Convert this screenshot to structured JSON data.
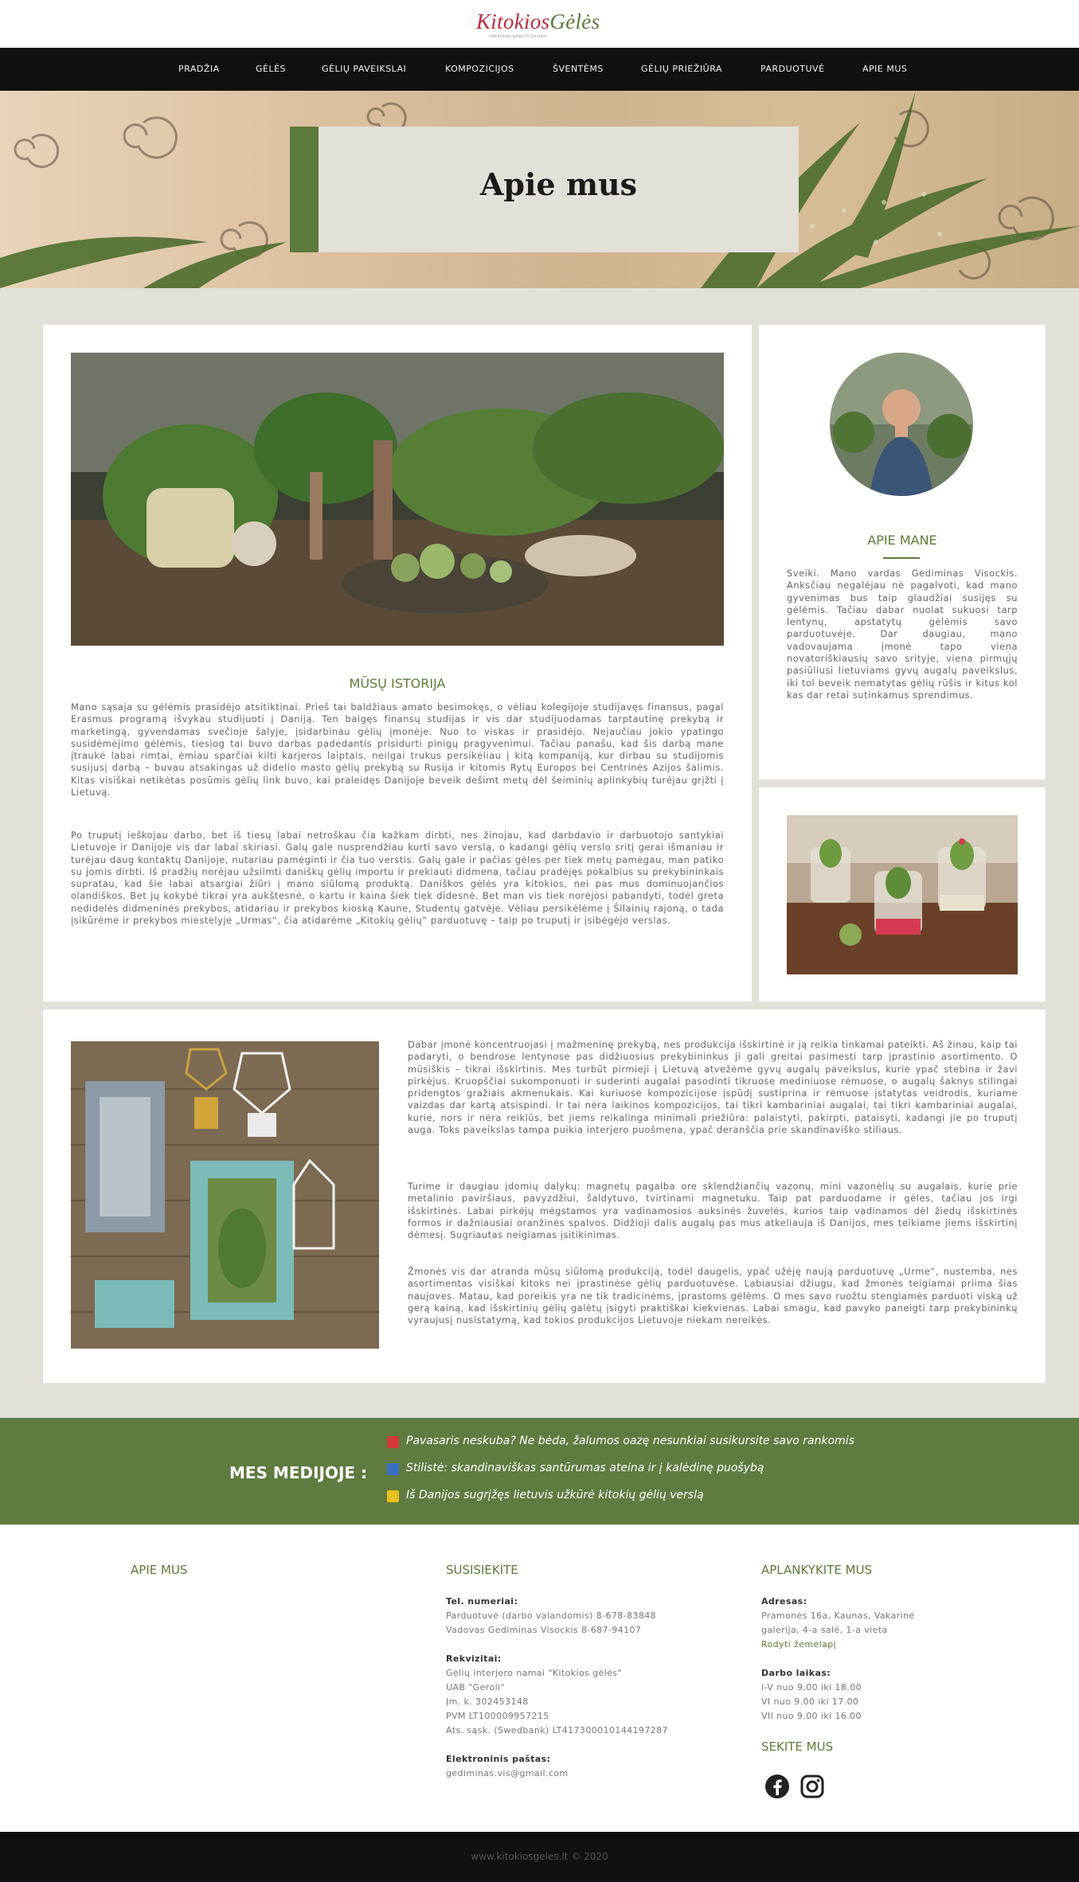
{
  "brand": {
    "logo_main_a": "Kitokios",
    "logo_main_b": "Gėlės",
    "logo_sub": "išskirtinės gėlės iš Danijos",
    "accent": "#5d7b3a"
  },
  "nav": [
    "PRADŽIA",
    "GĖLĖS",
    "GĖLIŲ PAVEIKSLAI",
    "KOMPOZICIJOS",
    "ŠVENTĖMS",
    "GĖLIŲ PRIEŽIŪRA",
    "PARDUOTUVĖ",
    "APIE MUS"
  ],
  "hero": {
    "title": "Apie mus"
  },
  "history": {
    "heading": "MŪSŲ ISTORIJA",
    "p1": "Mano sąsaja su gėlėmis prasidėjo atsitiktinai. Prieš tai baldžiaus amato besimokęs, o vėliau kolegijoje studijavęs finansus, pagal Erasmus programą išvykau studijuoti į Daniją. Ten baigęs finansų studijas ir vis dar studijuodamas tarptautinę prekybą ir marketingą, gyvendamas svečioje šalyje, įsidarbinau gėlių įmonėje. Nuo to viskas ir prasidėjo. Nejaučiau jokio ypatingo susidėmėjimo gėlėmis, tiesiog tai buvo darbas padedantis prisidurti pinigų pragyvenimui. Tačiau panašu, kad šis darbą mane įtraukė labai rimtai, ėmiau sparčiai kilti karjeros laiptais, neilgai trukus persikėliau į kitą kompaniją, kur dirbau su studijomis susijusį darbą – buvau atsakingas už didelio masto gėlių prekybą su Rusija ir kitomis Rytų Europos bei Centrinės Azijos šalimis. Kitas visiškai netikėtas posūmis gėlių link buvo, kai praleidęs Danijoje beveik dešimt metų dėl šeiminių aplinkybių turėjau grįžti į Lietuvą.",
    "p2": "Po truputį ieškojau darbo, bet iš tiesų labai netroškau čia kažkam dirbti, nes žinojau, kad darbdavio ir darbuotojo santykiai Lietuvoje ir Danijoje vis dar labai skiriasi. Galų gale nusprendžiau kurti savo verslą, o kadangi gėlių verslo sritį gerai išmaniau ir turėjau daug kontaktų Danijoje, nutariau pamėginti ir čia tuo verstis. Galų gale ir pačias gėles per tiek metų pamėgau, man patiko su jomis dirbti. Iš pradžių norėjau užsiimti daniškų gėlių importu ir prekiauti didmena, tačiau pradėjęs pokalbius su prekybininkais supratau, kad šie labai atsargiai žiūri į mano siūlomą produktą. Daniškos gėlės yra kitokios, nei pas mus dominuojančios olandiškos. Bet jų kokybė tikrai yra aukštesnė, o kartu ir kaina šiek tiek didesnė. Bet man vis tiek norėjosi pabandyti, todėl greta nedidelės didmeninės prekybos, atidariau ir prekybos kioską Kaune, Studentų gatvėje. Vėliau persikėlėme į Šilainių rajoną, o tada įsikūrėme ir prekybos miestelyje „Urmas“, čia atidarėme „Kitokių gėlių“ parduotuvę – taip po truputį ir įsibėgėjo verslas."
  },
  "about_me": {
    "heading": "APIE MANE",
    "text": "Sveiki. Mano vardas Gediminas Visockis. Anksčiau negalėjau nė pagalvoti, kad mano gyvenimas bus taip glaudžiai susijęs su gėlėmis. Tačiau dabar nuolat sukuosi tarp lentynų, apstatytų gėlėmis savo parduotuvėje. Dar daugiau, mano vadovaujama įmonė tapo viena novatoriškiausių savo srityje, viena pirmųjų pasiūliusi lietuviams gyvų augalų paveikslus, iki tol beveik nematytas gėlių rūšis ir kitus kol kas dar retai sutinkamus sprendimus."
  },
  "company": {
    "p1": "Dabar įmonė koncentruojasi į mažmeninę prekybą, nes produkcija išskirtinė ir ją reikia tinkamai pateikti. Aš žinau, kaip tai padaryti, o bendrose lentynose pas didžiuosius prekybininkus ji gali greitai pasimesti tarp įprastinio asortimento. O mūsiškis – tikrai išskirtinis. Mes turbūt pirmieji į Lietuvą atvežėme gyvų augalų paveikslus, kurie ypač stebina ir žavi pirkėjus. Kruopščiai sukomponuoti ir suderinti augalai pasodinti tikruose mediniuose rėmuose, o augalų šaknys stilingai pridengtos gražiais akmenukais. Kai kuriuose kompozicijose įspūdį sustiprina ir rėmuose įstatytas veidrodis, kuriame vaizdas dar kartą atsispindi. Ir tai nėra laikinos kompozicijos, tai tikri kambariniai augalai, tai tikri kambariniai augalai, kurie, nors ir nėra reiklūs, bet jiems reikalinga minimali priežiūra: palaistyti, pakirpti, pataisyti, kadangi jie po truputį auga. Toks paveikslas tampa puikia interjero puošmena, ypač deranščia prie skandinaviško stiliaus.",
    "p2": "Turime ir daugiau įdomių dalykų: magnetų pagalba ore sklendžiančių vazonų, mini vazonėlių su augalais, kurie prie metalinio paviršiaus, pavyzdžiui, šaldytuvo, tvirtinami magnetuku. Taip pat parduodame ir gėles, tačiau jos irgi išskirtinės. Labai pirkėjų mėgstamos yra vadinamosios auksinės žuvelės, kurios taip vadinamos dėl žiedų išskirtinės formos ir dažniausiai oranžinės spalvos. Didžioji dalis augalų pas mus atkeliauja iš Danijos, mes teikiame jiems išskirtinį dėmesį. Sugriautas neigiamas įsitikinimas.",
    "p3": "Žmonės vis dar atranda mūsų siūlomą produkciją, todėl daugelis, ypač užėję naują parduotuvę „Urme“, nustemba, nes asortimentas visiškai kitoks nei įprastinėse gėlių parduotuvėse. Labiausiai džiugu, kad žmonės teigiamai priima šias naujoves. Matau, kad poreikis yra ne tik tradicinėms, įprastoms gėlėms. O mes savo ruožtu stengiamės parduoti viską už gerą kainą, kad išskirtinių gėlių galėtų įsigyti praktiškai kiekvienas. Labai smagu, kad pavyko paneigti tarp prekybininkų vyraujusį nusistatymą, kad tokios produkcijos Lietuvoje niekam nereikės."
  },
  "media": {
    "title": "MES MEDIJOJE :",
    "links": [
      {
        "text": "Pavasaris neskuba? Ne bėda, žalumos oazę nesunkiai susikursite savo rankomis",
        "icon": "news-icon",
        "color": "#d33b3b"
      },
      {
        "text": "Stilistė: skandinaviškas santūrumas ateina ir į kalėdinę puošybą",
        "icon": "news-icon",
        "color": "#3b6fc2"
      },
      {
        "text": "Iš Danijos sugrįžęs lietuvis užkūrė kitokių gėlių verslą",
        "icon": "news-icon",
        "color": "#e8c120"
      }
    ]
  },
  "footer": {
    "col1_title": "APIE MUS",
    "col2_title": "SUSISIEKITE",
    "phones_label": "Tel. numeriai:",
    "phones": [
      "Parduotuvė (darbo valandomis) 8-678-83848",
      "Vadovas Gediminas Visockis 8-687-94107"
    ],
    "req_label": "Rekvizitai:",
    "req": [
      "Gėlių interjero namai \"Kitokios gėlės\"",
      "UAB \"Geroli\"",
      "Įm. k. 302453148",
      "PVM LT100009957215",
      "Ats. sąsk. (Swedbank) LT417300010144197287"
    ],
    "email_label": "Elektroninis paštas:",
    "email": "gediminas.vis@gmail.com",
    "col3_title": "APLANKYKITE MUS",
    "address_label": "Adresas:",
    "address": [
      "Pramonės 16a, Kaunas, Vakarinė",
      "galerija, 4-a salė, 1-a vieta"
    ],
    "map_link": "Rodyti žemėlapį",
    "hours_label": "Darbo laikas:",
    "hours": [
      "I-V nuo 9.00 iki 18.00",
      "VI nuo 9.00 iki 17.00",
      "VII nuo 9.00 iki 16.00"
    ],
    "follow_title": "SEKITE MUS",
    "copyright": "www.kitokiosgeles.lt © 2020"
  }
}
